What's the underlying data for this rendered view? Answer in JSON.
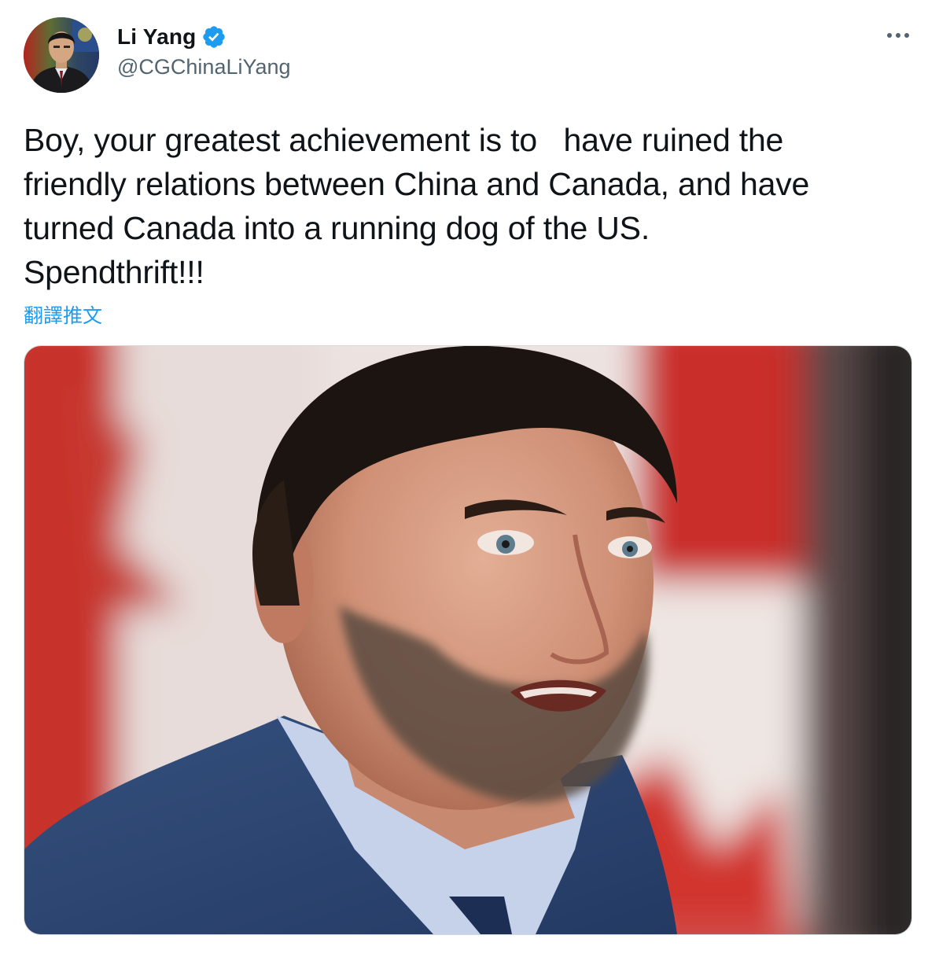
{
  "author": {
    "display_name": "Li Yang",
    "handle": "@CGChinaLiYang",
    "verified": true
  },
  "tweet": {
    "text": "Boy, your greatest achievement is to   have ruined the\nfriendly relations between China and Canada, and have\nturned Canada into a running dog of the US.\nSpendthrift!!!",
    "translate_label": "翻譯推文"
  },
  "icons": {
    "verified": "verified-badge-icon",
    "more": "more-options-icon"
  },
  "colors": {
    "accent": "#1d9bf0",
    "text": "#0f1419",
    "secondary": "#536471",
    "border": "#cfd9de"
  }
}
